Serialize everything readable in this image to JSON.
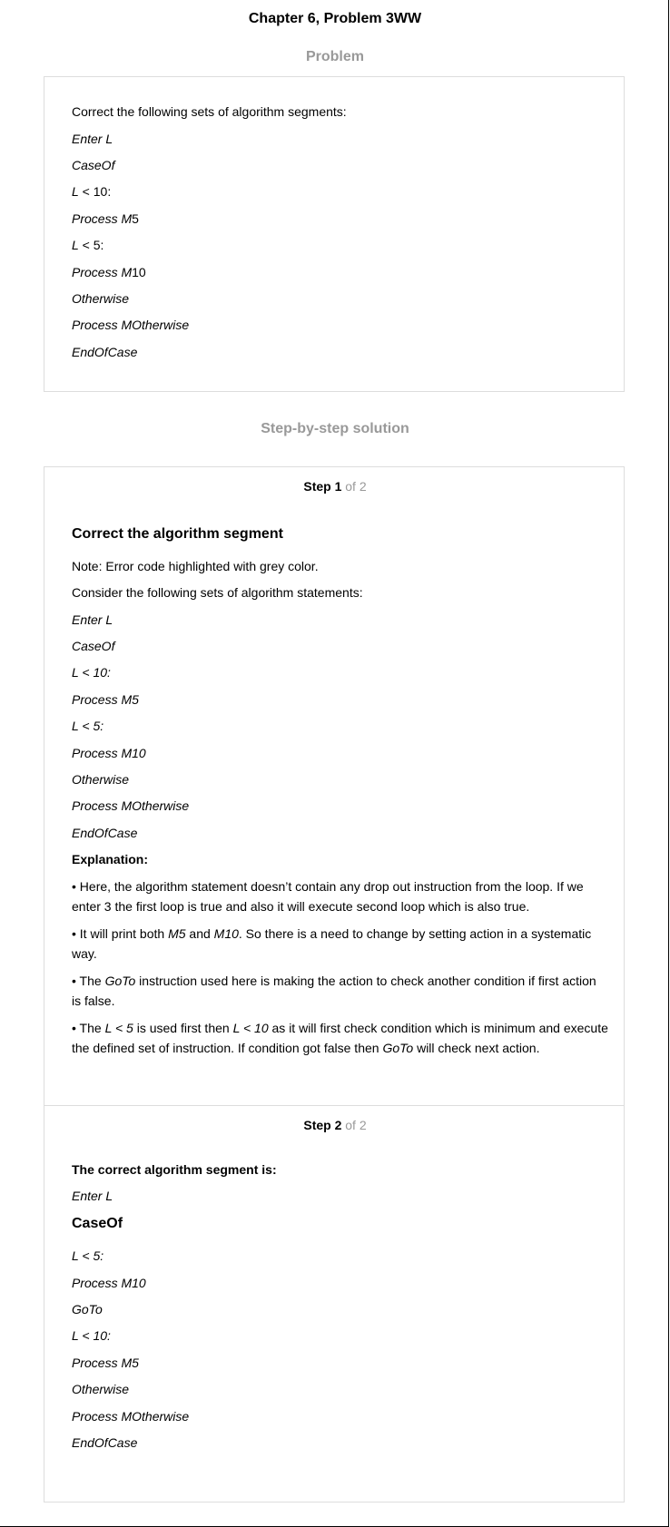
{
  "page_title": "Chapter 6, Problem 3WW",
  "problem": {
    "heading": "Problem",
    "intro": "Correct the following sets of algorithm segments:",
    "lines": {
      "l1": "Enter L",
      "l2": "CaseOf",
      "l3a": "L",
      "l3b": " < 10:",
      "l4a": "Process M",
      "l4b": "5",
      "l5a": "L",
      "l5b": " < 5:",
      "l6a": "Process M",
      "l6b": "10",
      "l7": "Otherwise",
      "l8": "Process MOtherwise",
      "l9": "EndOfCase"
    }
  },
  "solution": {
    "heading": "Step-by-step solution",
    "step1": {
      "label_bold": "Step 1",
      "label_of": " of 2",
      "heading": "Correct the algorithm segment",
      "note": "Note: Error code highlighted with grey color.",
      "consider": "Consider the following sets of algorithm statements:",
      "code": [
        "Enter L",
        "CaseOf",
        "L < 10:",
        "Process M5",
        "L < 5:",
        "Process M10",
        "Otherwise",
        "Process MOtherwise",
        "EndOfCase"
      ],
      "explanation_label": "Explanation:",
      "bullet1": "• Here, the algorithm statement doesn’t contain any drop out instruction from the loop. If we enter 3 the first loop is true and also it will execute second loop which is also true.",
      "bullet2": {
        "a": "• It will print both ",
        "b": "M5",
        "c": " and ",
        "d": "M10",
        "e": ". So there is a need to change by setting action in a systematic way."
      },
      "bullet3": {
        "a": "• The ",
        "b": "GoTo",
        "c": " instruction used here is making the action to check another condition if first action is false."
      },
      "bullet4": {
        "a": "• The ",
        "b": "L < 5",
        "c": " is used first then ",
        "d": "L < 10",
        "e": " as it will first check condition which is minimum and execute the defined set of instruction. If condition got false then ",
        "f": "GoTo",
        "g": " will check next action."
      }
    },
    "step2": {
      "label_bold": "Step 2",
      "label_of": " of 2",
      "heading": "The correct algorithm segment is:",
      "line1": "Enter L",
      "line2": "CaseOf",
      "code": [
        "L < 5:",
        "Process M10",
        "GoTo",
        "L < 10:",
        "Process M5",
        "Otherwise",
        "Process MOtherwise",
        "EndOfCase"
      ]
    }
  }
}
